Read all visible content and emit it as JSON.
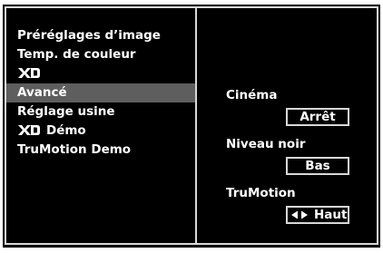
{
  "menu": {
    "items": [
      {
        "label": "Préréglages d’image"
      },
      {
        "label": "Temp. de couleur"
      },
      {
        "label": ""
      },
      {
        "label": "Avancé"
      },
      {
        "label": "Réglage usine"
      },
      {
        "label": "Démo"
      },
      {
        "label": "TruMotion Demo"
      }
    ],
    "selected_index": 3
  },
  "settings": {
    "cinema": {
      "label": "Cinéma",
      "value": "Arrêt"
    },
    "black_level": {
      "label": "Niveau noir",
      "value": "Bas"
    },
    "trumotion": {
      "label": "TruMotion",
      "value": "Haut",
      "icon": "left-right-arrows-icon"
    }
  },
  "colors": {
    "background": "#000000",
    "border": "#d8d8d8",
    "selected_row": "#5e5e5e",
    "text": "#ffffff"
  },
  "logos": {
    "xd": "XD"
  }
}
